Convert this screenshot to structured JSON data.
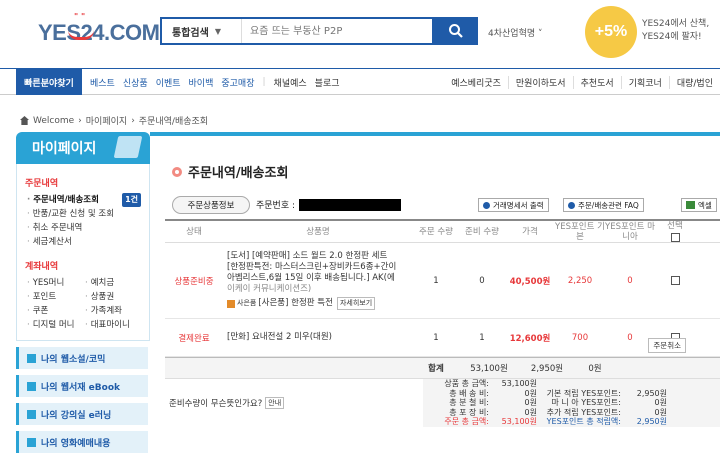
{
  "header": {
    "logo": "YES24.COM",
    "search_category": "통합검색",
    "search_placeholder": "요즘 뜨는 부동산 P2P",
    "trend": "4차산업혁명",
    "promo_percent": "+5%",
    "promo_line1": "YES24에서 산책,",
    "promo_line2": "YES24에 팔자!"
  },
  "nav": {
    "quick": "빠른분야찾기",
    "items": [
      "베스트",
      "신상품",
      "이벤트",
      "바이백",
      "중고매장"
    ],
    "plain_items": [
      "채널예스",
      "블로그"
    ],
    "right_items": [
      "예스베리굿즈",
      "만원이하도서",
      "추천도서",
      "기획코너",
      "대량/법인"
    ]
  },
  "breadcrumb": [
    "Welcome",
    "마이페이지",
    "주문내역/배송조회"
  ],
  "sidebar": {
    "title": "마이페이지",
    "section1": "주문내역",
    "items1": [
      {
        "label": "주문내역/배송조회",
        "badge": "1건"
      },
      {
        "label": "반품/교환 신청 및 조회"
      },
      {
        "label": "취소 주문내역"
      },
      {
        "label": "세금계산서"
      }
    ],
    "section2": "계좌내역",
    "items2": [
      "YES머니",
      "예치금",
      "포인트",
      "상품권",
      "쿠폰",
      "가족계좌",
      "디지털 머니",
      "대표마이니"
    ],
    "links": [
      "나의 웹소설/코믹",
      "나의 웹서재 eBook",
      "나의 강의실 e러닝",
      "나의 영화예매내용"
    ]
  },
  "main": {
    "title": "주문내역/배송조회",
    "order_button": "주문상품정보",
    "order_no_label": "주문번호 :",
    "buttons": [
      "거래명세서 출력",
      "주문/배송관련 FAQ",
      "엑셀"
    ],
    "headers": [
      "상태",
      "상품명",
      "주문 수량",
      "준비 수량",
      "가격",
      "YES포인트 기본",
      "YES포인트 마니아",
      "선택"
    ],
    "rows": [
      {
        "status": "상품준비중",
        "name_lines": [
          "[도서] [예약판매] 소드 월드 2.0 한정판 세트",
          "[한정판특전: 마스터스크린+장비카드6종+간이",
          "아벱리스트,6월 15일 이후 배송됩니다.] AK(에",
          "이케이 커뮤니케이션즈)"
        ],
        "gift_label": "사은품",
        "gift_text": "[사은품] 한정판 특전",
        "gift_btn": "자세히보기",
        "order_qty": "1",
        "ready_qty": "0",
        "price": "40,500원",
        "pts_basic": "2,250",
        "pts_mania": "0"
      },
      {
        "status": "결제완료",
        "name_lines": [
          "[만화] 요내전설 2 미우(대원)"
        ],
        "order_qty": "1",
        "ready_qty": "1",
        "price": "12,600원",
        "pts_basic": "700",
        "pts_mania": "0",
        "cancel": "주문취소"
      }
    ],
    "sum": {
      "label": "합계",
      "price": "53,100원",
      "pts_basic": "2,950원",
      "pts_mania": "0원"
    },
    "detail_left": "준비수량이 무슨뜻인가요?",
    "detail_help": "안내",
    "details": [
      {
        "l1": "상품 총 금액:",
        "v1": "53,100원",
        "l2": "",
        "v2": ""
      },
      {
        "l1": "총 배 송 비:",
        "v1": "0원",
        "l2": "기본 적립 YES포인트:",
        "v2": "2,950원"
      },
      {
        "l1": "총 분 철 비:",
        "v1": "0원",
        "l2": "마 니 아 YES포인트:",
        "v2": "0원"
      },
      {
        "l1": "총 포 장 비:",
        "v1": "0원",
        "l2": "추가 적립 YES포인트:",
        "v2": "0원"
      },
      {
        "l1": "주문 총 금액:",
        "v1": "53,100원",
        "l2": "YES포인트 총 적립액:",
        "v2": "2,950원"
      }
    ]
  }
}
